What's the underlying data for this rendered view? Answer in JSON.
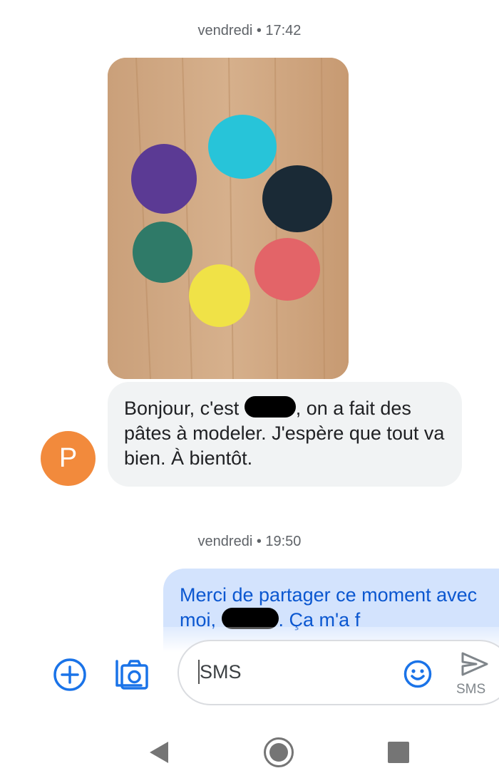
{
  "conversation": {
    "messages": [
      {
        "timestamp": "vendredi • 17:42",
        "direction": "incoming",
        "has_photo": true,
        "photo_description_icon": "image-icon",
        "text_before": "Bonjour, c'est ",
        "text_after": ", on a fait des pâtes à modeler. J'espère que tout va bien. À bientôt.",
        "sender_initial": "P",
        "avatar_color": "#f28a3c"
      },
      {
        "timestamp": "vendredi • 19:50",
        "direction": "outgoing",
        "text_before": "Merci de partager ce moment avec moi, ",
        "text_after": ". Ça m'a f"
      }
    ]
  },
  "composer": {
    "placeholder": "SMS",
    "send_label": "SMS",
    "icons": {
      "attach": "add-circle-icon",
      "media": "gallery-camera-icon",
      "emoji": "emoji-icon",
      "send": "send-icon"
    }
  },
  "navigation": {
    "icons": [
      "back-icon",
      "home-icon",
      "recents-icon"
    ]
  },
  "colors": {
    "accent": "#1a73e8",
    "incoming_bubble": "#f1f3f4",
    "outgoing_bubble": "#d3e3fd",
    "outgoing_text": "#0b57d0"
  }
}
